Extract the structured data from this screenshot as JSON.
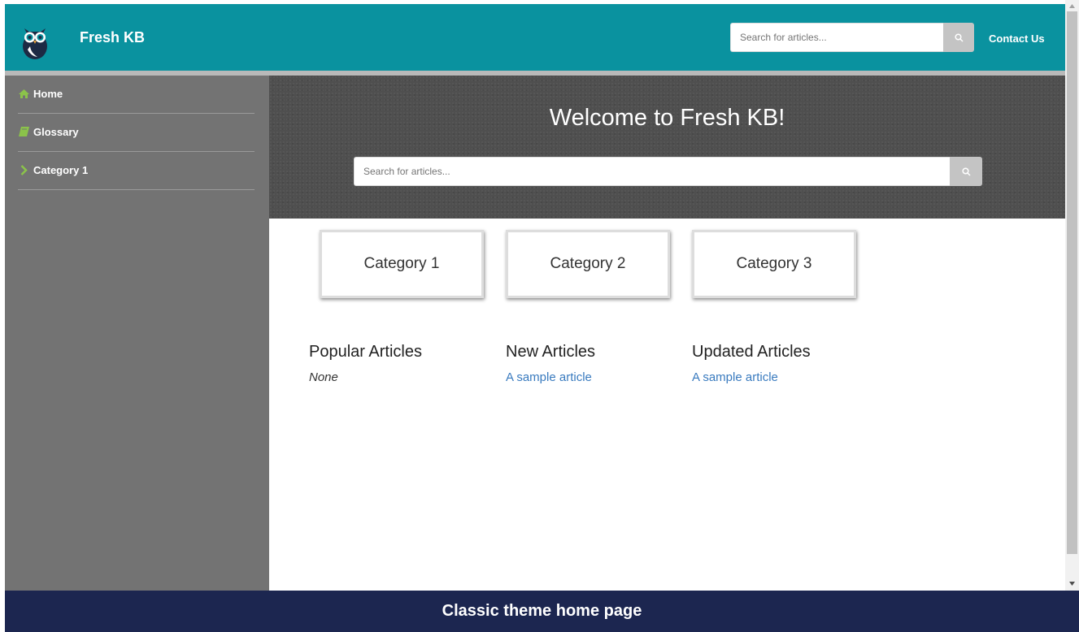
{
  "header": {
    "brand": "Fresh KB",
    "search_placeholder": "Search for articles...",
    "contact_label": "Contact Us",
    "color": "#0a929f"
  },
  "sidebar": {
    "items": [
      {
        "label": "Home",
        "icon": "home-icon"
      },
      {
        "label": "Glossary",
        "icon": "book-icon"
      },
      {
        "label": "Category 1",
        "icon": "chevron-right-icon"
      }
    ],
    "icon_color": "#8bc34a"
  },
  "hero": {
    "title": "Welcome to Fresh KB!",
    "search_placeholder": "Search for articles..."
  },
  "categories": [
    {
      "label": "Category 1"
    },
    {
      "label": "Category 2"
    },
    {
      "label": "Category 3"
    }
  ],
  "articles": {
    "popular": {
      "title": "Popular Articles",
      "empty_text": "None"
    },
    "new": {
      "title": "New Articles",
      "items": [
        "A sample article"
      ]
    },
    "updated": {
      "title": "Updated Articles",
      "items": [
        "A sample article"
      ]
    }
  },
  "caption": "Classic theme home page"
}
